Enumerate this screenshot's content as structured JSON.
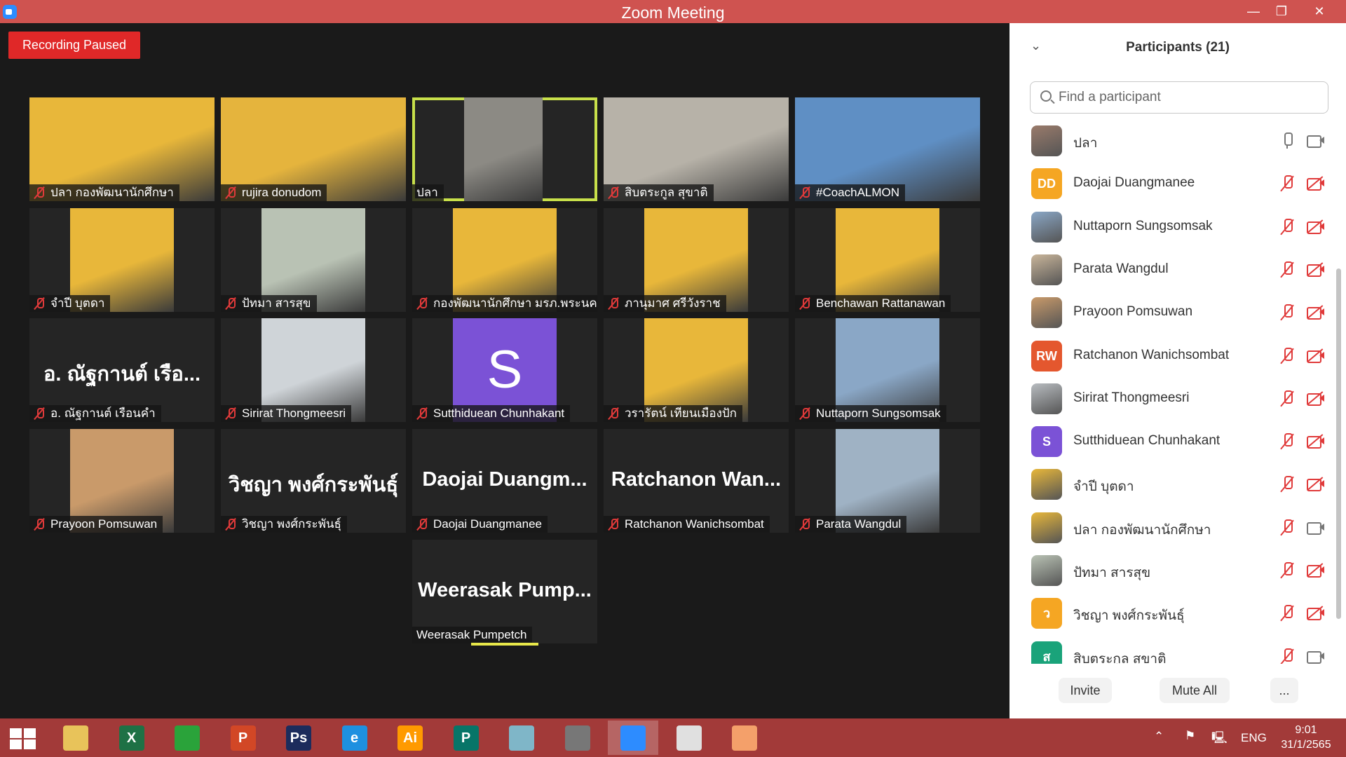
{
  "window": {
    "title": "Zoom Meeting",
    "minimize": "—",
    "restore": "❐",
    "close": "✕"
  },
  "recording": {
    "label": "Recording Paused"
  },
  "tiles": [
    {
      "name": "ปลา กองพัฒนานักศึกษา",
      "kind": "photo",
      "bg": "#e8b73a",
      "muted": true
    },
    {
      "name": "rujira donudom",
      "kind": "photo",
      "bg": "#e5b43d",
      "muted": true
    },
    {
      "name": "ปลา",
      "kind": "photo",
      "bg": "#8c8a84",
      "muted": false,
      "active": true
    },
    {
      "name": "สิบตระกูล สุขาติ",
      "kind": "photo",
      "bg": "#b7b2a8",
      "muted": true
    },
    {
      "name": "#CoachALMON",
      "kind": "photo",
      "bg": "#5f8fc4",
      "muted": true
    },
    {
      "name": "จำปี บุตดา",
      "kind": "photo",
      "bg": "#e8b73a",
      "muted": true
    },
    {
      "name": "ปัทมา สารสุข",
      "kind": "photo",
      "bg": "#b9c2b4",
      "muted": true
    },
    {
      "name": "กองพัฒนานักศึกษา มรภ.พระนคร",
      "kind": "photo",
      "bg": "#e8b73a",
      "muted": true
    },
    {
      "name": "ภานุมาศ ศรีวังราช",
      "kind": "photo",
      "bg": "#e8b73a",
      "muted": true
    },
    {
      "name": "Benchawan Rattanawan",
      "kind": "photo",
      "bg": "#e8b73a",
      "muted": true
    },
    {
      "name": "อ. ณัฐกานต์ เรือนคำ",
      "kind": "text",
      "big": "อ. ณัฐกานต์ เรือ...",
      "muted": true
    },
    {
      "name": "Sirirat Thongmeesri",
      "kind": "photo",
      "bg": "#cfd4d8",
      "muted": true
    },
    {
      "name": "Sutthiduean Chunhakant",
      "kind": "letter",
      "letter": "S",
      "bg": "#7b52d6",
      "muted": true
    },
    {
      "name": "วรารัตน์ เทียนเมืองปัก",
      "kind": "photo",
      "bg": "#e8b73a",
      "muted": true
    },
    {
      "name": "Nuttaporn Sungsomsak",
      "kind": "photo",
      "bg": "#8aa7c6",
      "muted": true
    },
    {
      "name": "Prayoon Pomsuwan",
      "kind": "photo",
      "bg": "#c99a6a",
      "muted": true
    },
    {
      "name": "วิชญา พงศ์กระพันธุ์",
      "kind": "text",
      "big": "วิชญา พงศ์กระพันธุ์",
      "muted": true
    },
    {
      "name": "Daojai Duangmanee",
      "kind": "text",
      "big": "Daojai Duangm...",
      "muted": true
    },
    {
      "name": "Ratchanon Wanichsombat",
      "kind": "text",
      "big": "Ratchanon Wan...",
      "muted": true
    },
    {
      "name": "Parata Wangdul",
      "kind": "photo",
      "bg": "#9fb2c4",
      "muted": true
    },
    {
      "name": "Weerasak Pumpetch",
      "kind": "text",
      "big": "Weerasak Pump...",
      "muted": false
    }
  ],
  "panel": {
    "title": "Participants (21)",
    "search_placeholder": "Find a participant",
    "participants": [
      {
        "name": "ปลา",
        "avatar": "photo",
        "color": "#9a7b6b",
        "mic": "on",
        "cam": "on"
      },
      {
        "name": "Daojai Duangmanee",
        "avatar": "DD",
        "color": "#f5a623",
        "mic": "off",
        "cam": "off"
      },
      {
        "name": "Nuttaporn Sungsomsak",
        "avatar": "photo",
        "color": "#8aa7c6",
        "mic": "off",
        "cam": "off"
      },
      {
        "name": "Parata Wangdul",
        "avatar": "photo",
        "color": "#c9b59a",
        "mic": "off",
        "cam": "off"
      },
      {
        "name": "Prayoon Pomsuwan",
        "avatar": "photo",
        "color": "#c99a6a",
        "mic": "off",
        "cam": "off"
      },
      {
        "name": "Ratchanon Wanichsombat",
        "avatar": "RW",
        "color": "#e4572e",
        "mic": "off",
        "cam": "off"
      },
      {
        "name": "Sirirat Thongmeesri",
        "avatar": "photo",
        "color": "#b8bcc0",
        "mic": "off",
        "cam": "off"
      },
      {
        "name": "Sutthiduean Chunhakant",
        "avatar": "S",
        "color": "#7b52d6",
        "mic": "off",
        "cam": "off"
      },
      {
        "name": "จำปี บุตดา",
        "avatar": "photo",
        "color": "#e8b73a",
        "mic": "off",
        "cam": "off"
      },
      {
        "name": "ปลา กองพัฒนานักศึกษา",
        "avatar": "photo",
        "color": "#e8b73a",
        "mic": "off",
        "cam": "on"
      },
      {
        "name": "ปัทมา สารสุข",
        "avatar": "photo",
        "color": "#b9c2b4",
        "mic": "off",
        "cam": "off"
      },
      {
        "name": "วิชญา พงศ์กระพันธุ์",
        "avatar": "ว",
        "color": "#f5a623",
        "mic": "off",
        "cam": "off"
      },
      {
        "name": "สิบตระกูล สุขาติ",
        "avatar": "ส",
        "color": "#1aa37a",
        "mic": "off",
        "cam": "on"
      }
    ],
    "invite_label": "Invite",
    "mute_all_label": "Mute All",
    "more_label": "..."
  },
  "taskbar": {
    "apps": [
      {
        "name": "file-explorer",
        "glyph": "",
        "color": "#e8c35a"
      },
      {
        "name": "excel",
        "glyph": "X",
        "color": "#1e7145"
      },
      {
        "name": "store",
        "glyph": "",
        "color": "#2aa33a"
      },
      {
        "name": "powerpoint",
        "glyph": "P",
        "color": "#d24726"
      },
      {
        "name": "photoshop",
        "glyph": "Ps",
        "color": "#1c2c5c"
      },
      {
        "name": "internet-explorer",
        "glyph": "e",
        "color": "#1e90e0"
      },
      {
        "name": "illustrator",
        "glyph": "Ai",
        "color": "#ff9a00"
      },
      {
        "name": "publisher",
        "glyph": "P",
        "color": "#077568"
      },
      {
        "name": "notes",
        "glyph": "",
        "color": "#7fb6c8"
      },
      {
        "name": "photoscape",
        "glyph": "",
        "color": "#777777"
      },
      {
        "name": "zoom",
        "glyph": "",
        "color": "#2d8cff",
        "active": true
      },
      {
        "name": "chrome",
        "glyph": "",
        "color": "#e0e0e0"
      },
      {
        "name": "photo-app",
        "glyph": "",
        "color": "#f4a06a"
      }
    ],
    "language": "ENG",
    "time": "9:01",
    "date": "31/1/2565"
  }
}
